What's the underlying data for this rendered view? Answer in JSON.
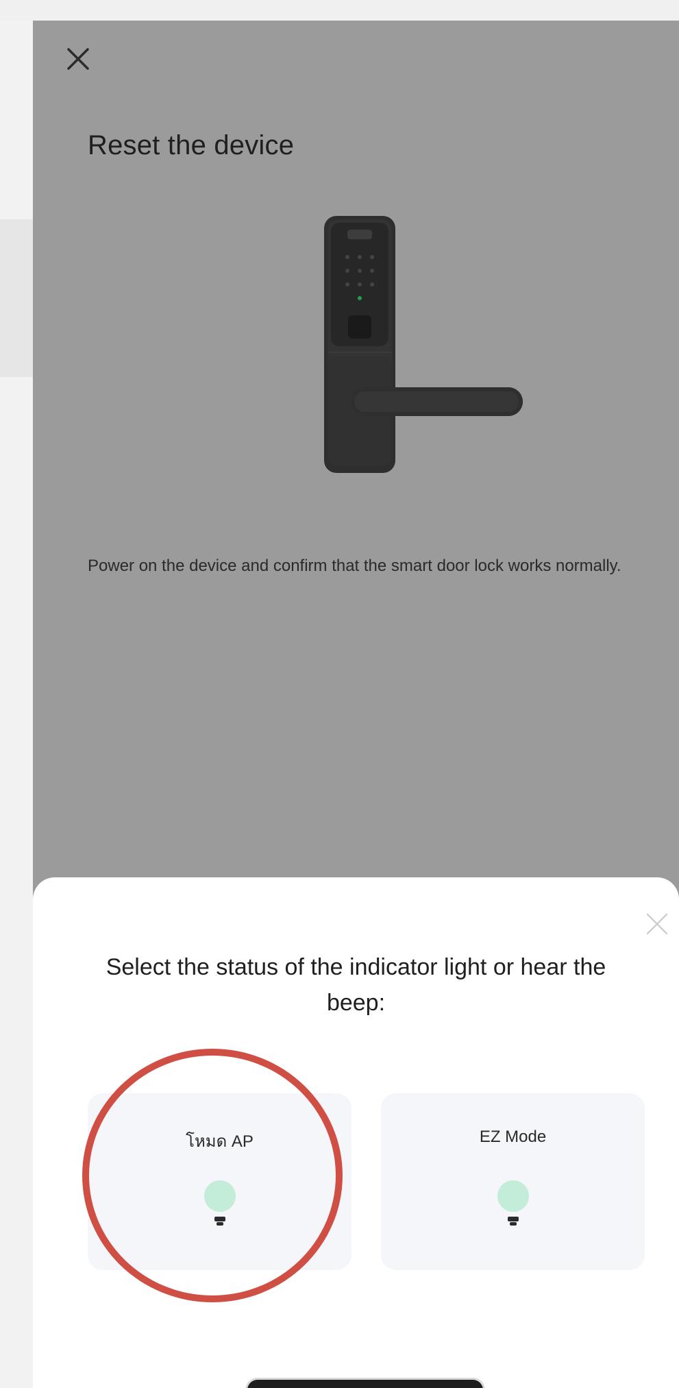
{
  "screen": {
    "title": "Reset the device",
    "description": "Power on the device and confirm that the smart door lock works normally.",
    "close_icon": "close-icon",
    "device_image": "smart-door-lock"
  },
  "sheet": {
    "title": "Select the status of the indicator light or hear the beep:",
    "close_icon": "close-icon",
    "options": [
      {
        "label": "โหมด AP",
        "icon": "light-bulb-icon"
      },
      {
        "label": "EZ Mode",
        "icon": "light-bulb-icon"
      }
    ]
  },
  "colors": {
    "overlay": "#9b9b9b",
    "highlight_ring": "#cf4f45",
    "bulb": "#bfe9d6"
  }
}
